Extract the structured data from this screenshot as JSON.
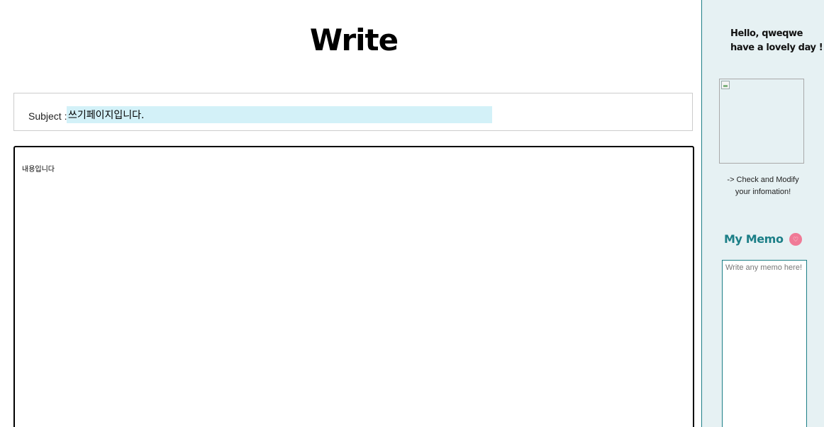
{
  "page": {
    "title": "Write"
  },
  "form": {
    "subject_label": "Subject :",
    "subject_value": "쓰기페이지입니다.",
    "content_value": "내용입니다"
  },
  "sidebar": {
    "greeting_line1": "Hello, qweqwe",
    "greeting_line2": "have a lovely day !",
    "modify_line1": "-> Check and Modify",
    "modify_line2": "your infomation!",
    "memo_title": "My Memo",
    "memo_icon": "heart-icon",
    "memo_placeholder": "Write any memo here!"
  },
  "colors": {
    "subject_bg": "#d3f1f8",
    "sidebar_bg": "#e6f1f3",
    "accent": "#1c7f87",
    "heart": "#f07a96"
  }
}
